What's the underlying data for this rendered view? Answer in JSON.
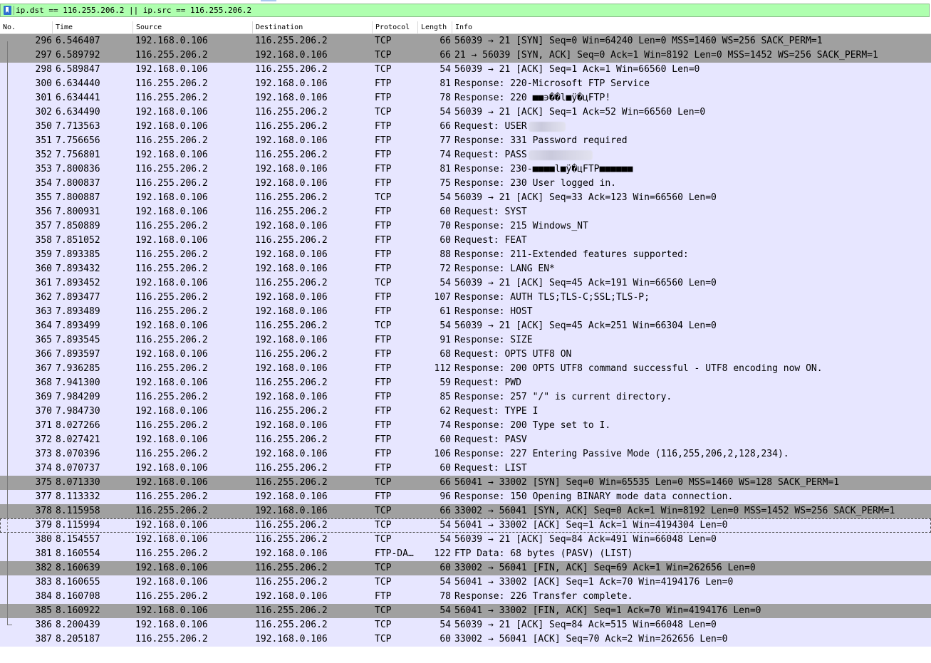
{
  "filter": {
    "value": "ip.dst == 116.255.206.2 || ip.src == 116.255.206.2"
  },
  "columns": [
    "No.",
    "Time",
    "Source",
    "Destination",
    "Protocol",
    "Length",
    "Info"
  ],
  "colors": {
    "row_default": "#e7e6ff",
    "row_marked": "#a0a0a0",
    "filter_ok": "#afffaf"
  },
  "icons": {
    "filter_bookmark": "bookmark-icon"
  },
  "packets": [
    {
      "no": "296",
      "time": "6.546407",
      "src": "192.168.0.106",
      "dst": "116.255.206.2",
      "proto": "TCP",
      "len": "66",
      "info": "56039 → 21 [SYN] Seq=0 Win=64240 Len=0 MSS=1460 WS=256 SACK_PERM=1",
      "marked": true,
      "rel": "start"
    },
    {
      "no": "297",
      "time": "6.589792",
      "src": "116.255.206.2",
      "dst": "192.168.0.106",
      "proto": "TCP",
      "len": "66",
      "info": "21 → 56039 [SYN, ACK] Seq=0 Ack=1 Win=8192 Len=0 MSS=1452 WS=256 SACK_PERM=1",
      "marked": true,
      "rel": "line"
    },
    {
      "no": "298",
      "time": "6.589847",
      "src": "192.168.0.106",
      "dst": "116.255.206.2",
      "proto": "TCP",
      "len": "54",
      "info": "56039 → 21 [ACK] Seq=1 Ack=1 Win=66560 Len=0",
      "marked": false,
      "rel": "line"
    },
    {
      "no": "300",
      "time": "6.634440",
      "src": "116.255.206.2",
      "dst": "192.168.0.106",
      "proto": "FTP",
      "len": "81",
      "info": "Response: 220-Microsoft FTP Service",
      "marked": false,
      "rel": "line"
    },
    {
      "no": "301",
      "time": "6.634441",
      "src": "116.255.206.2",
      "dst": "192.168.0.106",
      "proto": "FTP",
      "len": "78",
      "info": "Response: 220 ■■϶��l■ÿ�цFTP!",
      "marked": false,
      "rel": "line"
    },
    {
      "no": "302",
      "time": "6.634490",
      "src": "192.168.0.106",
      "dst": "116.255.206.2",
      "proto": "TCP",
      "len": "54",
      "info": "56039 → 21 [ACK] Seq=1 Ack=52 Win=66560 Len=0",
      "marked": false,
      "rel": "line"
    },
    {
      "no": "350",
      "time": "7.713563",
      "src": "192.168.0.106",
      "dst": "116.255.206.2",
      "proto": "FTP",
      "len": "66",
      "info": "Request: USER",
      "redact": 52,
      "marked": false,
      "rel": "line"
    },
    {
      "no": "351",
      "time": "7.756656",
      "src": "116.255.206.2",
      "dst": "192.168.0.106",
      "proto": "FTP",
      "len": "77",
      "info": "Response: 331 Password required",
      "marked": false,
      "rel": "line"
    },
    {
      "no": "352",
      "time": "7.756801",
      "src": "192.168.0.106",
      "dst": "116.255.206.2",
      "proto": "FTP",
      "len": "74",
      "info": "Request: PASS",
      "redact": 90,
      "marked": false,
      "rel": "line"
    },
    {
      "no": "353",
      "time": "7.800836",
      "src": "116.255.206.2",
      "dst": "192.168.0.106",
      "proto": "FTP",
      "len": "81",
      "info": "Response: 230-■■■■l■ÿ�цFTP■■■■■■",
      "marked": false,
      "rel": "line"
    },
    {
      "no": "354",
      "time": "7.800837",
      "src": "116.255.206.2",
      "dst": "192.168.0.106",
      "proto": "FTP",
      "len": "75",
      "info": "Response: 230 User logged in.",
      "marked": false,
      "rel": "line"
    },
    {
      "no": "355",
      "time": "7.800887",
      "src": "192.168.0.106",
      "dst": "116.255.206.2",
      "proto": "TCP",
      "len": "54",
      "info": "56039 → 21 [ACK] Seq=33 Ack=123 Win=66560 Len=0",
      "marked": false,
      "rel": "line"
    },
    {
      "no": "356",
      "time": "7.800931",
      "src": "192.168.0.106",
      "dst": "116.255.206.2",
      "proto": "FTP",
      "len": "60",
      "info": "Request: SYST",
      "marked": false,
      "rel": "line"
    },
    {
      "no": "357",
      "time": "7.850889",
      "src": "116.255.206.2",
      "dst": "192.168.0.106",
      "proto": "FTP",
      "len": "70",
      "info": "Response: 215 Windows_NT",
      "marked": false,
      "rel": "line"
    },
    {
      "no": "358",
      "time": "7.851052",
      "src": "192.168.0.106",
      "dst": "116.255.206.2",
      "proto": "FTP",
      "len": "60",
      "info": "Request: FEAT",
      "marked": false,
      "rel": "line"
    },
    {
      "no": "359",
      "time": "7.893385",
      "src": "116.255.206.2",
      "dst": "192.168.0.106",
      "proto": "FTP",
      "len": "88",
      "info": "Response: 211-Extended features supported:",
      "marked": false,
      "rel": "line"
    },
    {
      "no": "360",
      "time": "7.893432",
      "src": "116.255.206.2",
      "dst": "192.168.0.106",
      "proto": "FTP",
      "len": "72",
      "info": "Response:  LANG EN*",
      "marked": false,
      "rel": "line"
    },
    {
      "no": "361",
      "time": "7.893452",
      "src": "192.168.0.106",
      "dst": "116.255.206.2",
      "proto": "TCP",
      "len": "54",
      "info": "56039 → 21 [ACK] Seq=45 Ack=191 Win=66560 Len=0",
      "marked": false,
      "rel": "line"
    },
    {
      "no": "362",
      "time": "7.893477",
      "src": "116.255.206.2",
      "dst": "192.168.0.106",
      "proto": "FTP",
      "len": "107",
      "info": "Response:  AUTH TLS;TLS-C;SSL;TLS-P;",
      "marked": false,
      "rel": "line"
    },
    {
      "no": "363",
      "time": "7.893489",
      "src": "116.255.206.2",
      "dst": "192.168.0.106",
      "proto": "FTP",
      "len": "61",
      "info": "Response:  HOST",
      "marked": false,
      "rel": "line"
    },
    {
      "no": "364",
      "time": "7.893499",
      "src": "192.168.0.106",
      "dst": "116.255.206.2",
      "proto": "TCP",
      "len": "54",
      "info": "56039 → 21 [ACK] Seq=45 Ack=251 Win=66304 Len=0",
      "marked": false,
      "rel": "line"
    },
    {
      "no": "365",
      "time": "7.893545",
      "src": "116.255.206.2",
      "dst": "192.168.0.106",
      "proto": "FTP",
      "len": "91",
      "info": "Response:  SIZE",
      "marked": false,
      "rel": "line"
    },
    {
      "no": "366",
      "time": "7.893597",
      "src": "192.168.0.106",
      "dst": "116.255.206.2",
      "proto": "FTP",
      "len": "68",
      "info": "Request: OPTS UTF8 ON",
      "marked": false,
      "rel": "line"
    },
    {
      "no": "367",
      "time": "7.936285",
      "src": "116.255.206.2",
      "dst": "192.168.0.106",
      "proto": "FTP",
      "len": "112",
      "info": "Response: 200 OPTS UTF8 command successful - UTF8 encoding now ON.",
      "marked": false,
      "rel": "line"
    },
    {
      "no": "368",
      "time": "7.941300",
      "src": "192.168.0.106",
      "dst": "116.255.206.2",
      "proto": "FTP",
      "len": "59",
      "info": "Request: PWD",
      "marked": false,
      "rel": "line"
    },
    {
      "no": "369",
      "time": "7.984209",
      "src": "116.255.206.2",
      "dst": "192.168.0.106",
      "proto": "FTP",
      "len": "85",
      "info": "Response: 257 \"/\" is current directory.",
      "marked": false,
      "rel": "line"
    },
    {
      "no": "370",
      "time": "7.984730",
      "src": "192.168.0.106",
      "dst": "116.255.206.2",
      "proto": "FTP",
      "len": "62",
      "info": "Request: TYPE I",
      "marked": false,
      "rel": "line"
    },
    {
      "no": "371",
      "time": "8.027266",
      "src": "116.255.206.2",
      "dst": "192.168.0.106",
      "proto": "FTP",
      "len": "74",
      "info": "Response: 200 Type set to I.",
      "marked": false,
      "rel": "line"
    },
    {
      "no": "372",
      "time": "8.027421",
      "src": "192.168.0.106",
      "dst": "116.255.206.2",
      "proto": "FTP",
      "len": "60",
      "info": "Request: PASV",
      "marked": false,
      "rel": "line"
    },
    {
      "no": "373",
      "time": "8.070396",
      "src": "116.255.206.2",
      "dst": "192.168.0.106",
      "proto": "FTP",
      "len": "106",
      "info": "Response: 227 Entering Passive Mode (116,255,206,2,128,234).",
      "marked": false,
      "rel": "line"
    },
    {
      "no": "374",
      "time": "8.070737",
      "src": "192.168.0.106",
      "dst": "116.255.206.2",
      "proto": "FTP",
      "len": "60",
      "info": "Request: LIST",
      "marked": false,
      "rel": "line"
    },
    {
      "no": "375",
      "time": "8.071330",
      "src": "192.168.0.106",
      "dst": "116.255.206.2",
      "proto": "TCP",
      "len": "66",
      "info": "56041 → 33002 [SYN] Seq=0 Win=65535 Len=0 MSS=1460 WS=128 SACK_PERM=1",
      "marked": true,
      "rel": "line"
    },
    {
      "no": "377",
      "time": "8.113332",
      "src": "116.255.206.2",
      "dst": "192.168.0.106",
      "proto": "FTP",
      "len": "96",
      "info": "Response: 150 Opening BINARY mode data connection.",
      "marked": false,
      "rel": "line"
    },
    {
      "no": "378",
      "time": "8.115958",
      "src": "116.255.206.2",
      "dst": "192.168.0.106",
      "proto": "TCP",
      "len": "66",
      "info": "33002 → 56041 [SYN, ACK] Seq=0 Ack=1 Win=8192 Len=0 MSS=1452 WS=256 SACK_PERM=1",
      "marked": true,
      "rel": "line"
    },
    {
      "no": "379",
      "time": "8.115994",
      "src": "192.168.0.106",
      "dst": "116.255.206.2",
      "proto": "TCP",
      "len": "54",
      "info": "56041 → 33002 [ACK] Seq=1 Ack=1 Win=4194304 Len=0",
      "marked": false,
      "rel": "dot"
    },
    {
      "no": "380",
      "time": "8.154557",
      "src": "192.168.0.106",
      "dst": "116.255.206.2",
      "proto": "TCP",
      "len": "54",
      "info": "56039 → 21 [ACK] Seq=84 Ack=491 Win=66048 Len=0",
      "marked": false,
      "rel": "line"
    },
    {
      "no": "381",
      "time": "8.160554",
      "src": "116.255.206.2",
      "dst": "192.168.0.106",
      "proto": "FTP-DA…",
      "len": "122",
      "info": "FTP Data: 68 bytes (PASV) (LIST)",
      "marked": false,
      "rel": "line"
    },
    {
      "no": "382",
      "time": "8.160639",
      "src": "192.168.0.106",
      "dst": "116.255.206.2",
      "proto": "TCP",
      "len": "60",
      "info": "33002 → 56041 [FIN, ACK] Seq=69 Ack=1 Win=262656 Len=0",
      "marked": true,
      "rel": "line"
    },
    {
      "no": "383",
      "time": "8.160655",
      "src": "192.168.0.106",
      "dst": "116.255.206.2",
      "proto": "TCP",
      "len": "54",
      "info": "56041 → 33002 [ACK] Seq=1 Ack=70 Win=4194176 Len=0",
      "marked": false,
      "rel": "line"
    },
    {
      "no": "384",
      "time": "8.160708",
      "src": "116.255.206.2",
      "dst": "192.168.0.106",
      "proto": "FTP",
      "len": "78",
      "info": "Response: 226 Transfer complete.",
      "marked": false,
      "rel": "line"
    },
    {
      "no": "385",
      "time": "8.160922",
      "src": "192.168.0.106",
      "dst": "116.255.206.2",
      "proto": "TCP",
      "len": "54",
      "info": "56041 → 33002 [FIN, ACK] Seq=1 Ack=70 Win=4194176 Len=0",
      "marked": true,
      "rel": "line"
    },
    {
      "no": "386",
      "time": "8.200439",
      "src": "192.168.0.106",
      "dst": "116.255.206.2",
      "proto": "TCP",
      "len": "54",
      "info": "56039 → 21 [ACK] Seq=84 Ack=515 Win=66048 Len=0",
      "marked": false,
      "rel": "end"
    },
    {
      "no": "387",
      "time": "8.205187",
      "src": "116.255.206.2",
      "dst": "192.168.0.106",
      "proto": "TCP",
      "len": "60",
      "info": "33002 → 56041 [ACK] Seq=70 Ack=2 Win=262656 Len=0",
      "marked": false,
      "rel": ""
    }
  ]
}
